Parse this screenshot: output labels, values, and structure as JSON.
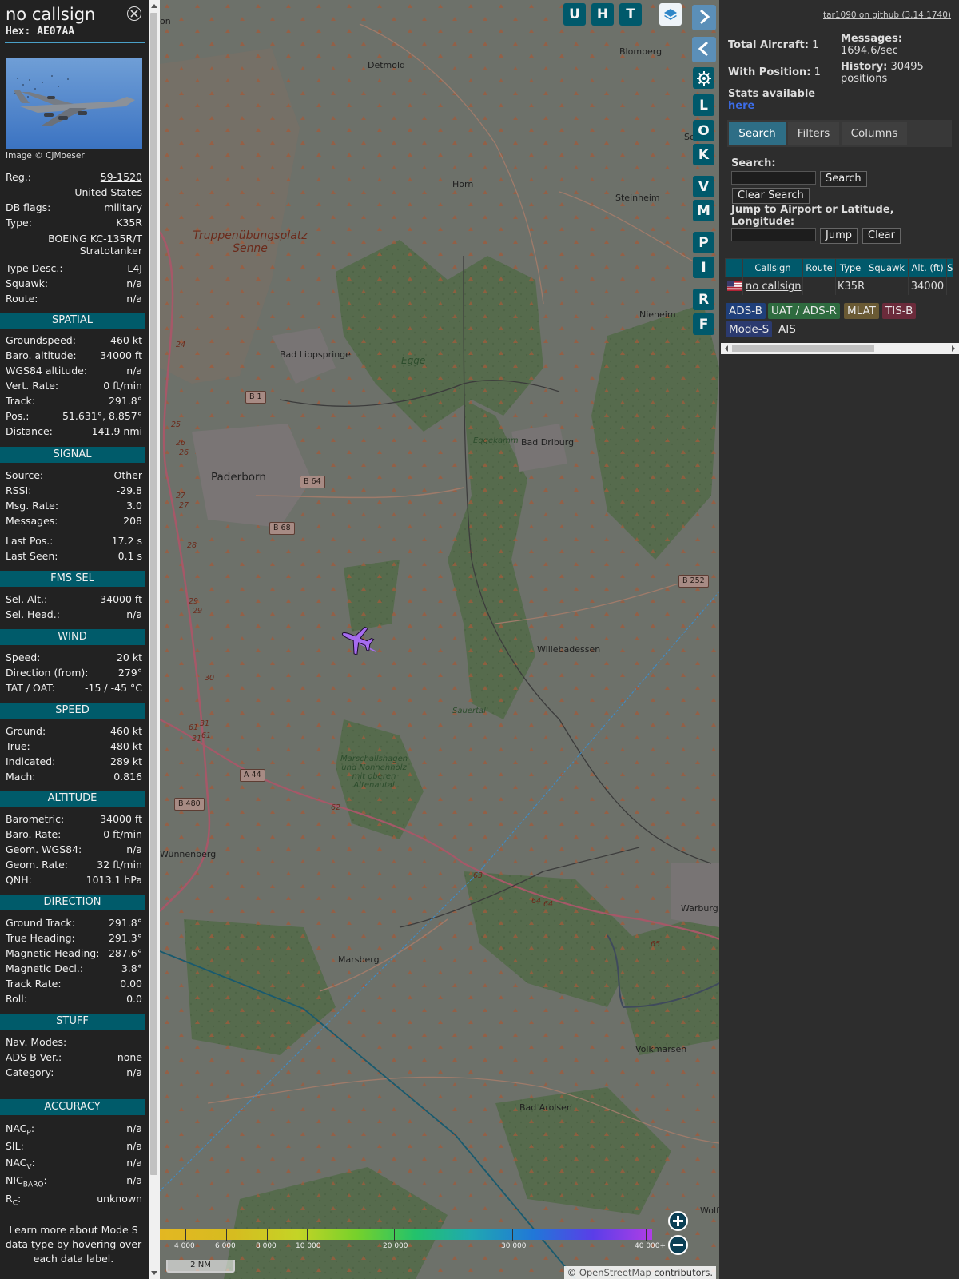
{
  "info": {
    "callsign": "no callsign",
    "hex": "Hex: AE07AA",
    "photo_credit": "Image © CJMoeser",
    "reg_label": "Reg.:",
    "reg_value": "59-1520",
    "country": "United States",
    "dbflags_label": "DB flags:",
    "dbflags_value": "military",
    "type_label": "Type:",
    "type_value": "K35R",
    "type_full_1": "BOEING KC-135R/T",
    "type_full_2": "Stratotanker",
    "typedesc_label": "Type Desc.:",
    "typedesc_value": "L4J",
    "squawk_label": "Squawk:",
    "squawk_value": "n/a",
    "route_label": "Route:",
    "route_value": "n/a",
    "sections": {
      "spatial": "SPATIAL",
      "signal": "SIGNAL",
      "fmssel": "FMS SEL",
      "wind": "WIND",
      "speed": "SPEED",
      "altitude": "ALTITUDE",
      "direction": "DIRECTION",
      "stuff": "STUFF",
      "accuracy": "ACCURACY"
    },
    "spatial": [
      [
        "Groundspeed:",
        "460 kt"
      ],
      [
        "Baro. altitude:",
        "34000 ft"
      ],
      [
        "WGS84 altitude:",
        "n/a"
      ],
      [
        "Vert. Rate:",
        "0 ft/min"
      ],
      [
        "Track:",
        "291.8°"
      ],
      [
        "Pos.:",
        "51.631°, 8.857°"
      ],
      [
        "Distance:",
        "141.9 nmi"
      ]
    ],
    "signal": [
      [
        "Source:",
        "Other"
      ],
      [
        "RSSI:",
        "-29.8"
      ],
      [
        "Msg. Rate:",
        "3.0"
      ],
      [
        "Messages:",
        "208"
      ],
      [
        "Last Pos.:",
        "17.2 s"
      ],
      [
        "Last Seen:",
        "0.1 s"
      ]
    ],
    "fmssel": [
      [
        "Sel. Alt.:",
        "34000 ft"
      ],
      [
        "Sel. Head.:",
        "n/a"
      ]
    ],
    "wind": [
      [
        "Speed:",
        "20 kt"
      ],
      [
        "Direction (from):",
        "279°"
      ],
      [
        "TAT / OAT:",
        "-15 / -45 °C"
      ]
    ],
    "speed": [
      [
        "Ground:",
        "460 kt"
      ],
      [
        "True:",
        "480 kt"
      ],
      [
        "Indicated:",
        "289 kt"
      ],
      [
        "Mach:",
        "0.816"
      ]
    ],
    "altitude": [
      [
        "Barometric:",
        "34000 ft"
      ],
      [
        "Baro. Rate:",
        "0 ft/min"
      ],
      [
        "Geom. WGS84:",
        "n/a"
      ],
      [
        "Geom. Rate:",
        "32 ft/min"
      ],
      [
        "QNH:",
        "1013.1 hPa"
      ]
    ],
    "direction": [
      [
        "Ground Track:",
        "291.8°"
      ],
      [
        "True Heading:",
        "291.3°"
      ],
      [
        "Magnetic Heading:",
        "287.6°"
      ],
      [
        "Magnetic Decl.:",
        "3.8°"
      ],
      [
        "Track Rate:",
        "0.00"
      ],
      [
        "Roll:",
        "0.0"
      ]
    ],
    "stuff": [
      [
        "Nav. Modes:",
        ""
      ],
      [
        "ADS-B Ver.:",
        "none"
      ],
      [
        "Category:",
        "n/a"
      ]
    ],
    "accuracy": {
      "nacp_main": "NAC",
      "nacp_sub": "P",
      "nacp_value": "n/a",
      "sil_label": "SIL:",
      "sil_value": "n/a",
      "nacv_main": "NAC",
      "nacv_sub": "V",
      "nacv_value": "n/a",
      "nicbaro_main": "NIC",
      "nicbaro_sub": "BARO",
      "nicbaro_value": "n/a",
      "rc_main": "R",
      "rc_sub": "C",
      "rc_value": "unknown"
    },
    "footnote": "Learn more about Mode S data type by hovering over each data label."
  },
  "map": {
    "places": {
      "detmold": "Detmold",
      "blomberg": "Blomberg",
      "horn": "Horn",
      "steinheim": "Steinheim",
      "nieheim": "Nieheim",
      "lippspringe": "Bad Lippspringe",
      "paderborn": "Paderborn",
      "driburg": "Bad Driburg",
      "willebadessen": "Willebadessen",
      "wunnenberg": "Wünnenberg",
      "marsberg": "Marsberg",
      "warburg": "Warburg",
      "volkmarsen": "Volkmarsen",
      "arolsen": "Bad Arolsen",
      "wolf": "Wolf",
      "sch": "Sch",
      "on": "on",
      "senne": "Truppenübungsplatz Senne",
      "egge": "Egge",
      "eggekamm": "Eggekamm",
      "sauertal": "Sauertal",
      "marschall": "Marschallshagen und Nonnenholz mit oberen Altenautal"
    },
    "roads": {
      "b1": "B 1",
      "b64": "B 64",
      "b68": "B 68",
      "b252": "B 252",
      "a44": "A 44",
      "b480": "B 480",
      "n24": "24",
      "n25": "25",
      "n26a": "26",
      "n26b": "26",
      "n27a": "27",
      "n27b": "27",
      "n28": "28",
      "n29a": "29",
      "n29b": "29",
      "n30": "30",
      "n31a": "31",
      "n31b": "31",
      "n61a": "61",
      "n61b": "61",
      "n62": "62",
      "n63": "63",
      "n64a": "64",
      "n64b": "64",
      "n65": "65"
    },
    "buttons": {
      "u": "U",
      "h": "H",
      "t": "T",
      "l": "L",
      "o": "O",
      "k": "K",
      "v": "V",
      "m": "M",
      "p": "P",
      "i": "I",
      "r": "R",
      "f": "F"
    },
    "altitude_legend": [
      "4 000",
      "6 000",
      "8 000",
      "10 000",
      "20 000",
      "30 000",
      "40 000+"
    ],
    "scale": "2 NM",
    "attribution_prefix": "© ",
    "attribution_link": "OpenStreetMap",
    "attribution_suffix": " contributors.",
    "aircraft_color": "#a66cf0"
  },
  "right": {
    "github": "tar1090 on github (3.14.1740)",
    "total_label": "Total Aircraft:",
    "total_value": "1",
    "withpos_label": "With Position:",
    "withpos_value": "1",
    "messages_label": "Messages:",
    "messages_value": "1694.6/sec",
    "history_label": "History:",
    "history_value": "30495",
    "history_unit": "positions",
    "stats_text": "Stats available",
    "stats_link": "here",
    "tabs": [
      "Search",
      "Filters",
      "Columns"
    ],
    "search_label": "Search:",
    "search_button": "Search",
    "clear_search": "Clear Search",
    "jump_label": "Jump to Airport or Latitude, Longitude:",
    "jump_button": "Jump",
    "clear_button": "Clear",
    "table_headers": [
      "Callsign",
      "Route",
      "Type",
      "Squawk",
      "Alt. (ft)",
      "S"
    ],
    "row": {
      "callsign": "no callsign",
      "route": "",
      "type": "K35R",
      "squawk": "",
      "alt": "34000"
    },
    "sources": [
      "ADS-B",
      "UAT / ADS-R",
      "MLAT",
      "TIS-B",
      "Mode-S",
      "AIS"
    ]
  },
  "colors": {
    "panel_header": "#005b6a",
    "accent": "#2e6e86",
    "adsb": "#1f3f7a",
    "uat": "#2e6b3f",
    "mlat": "#6a5a34",
    "tisb": "#6b2b3b",
    "modes": "#2b3a6f"
  }
}
